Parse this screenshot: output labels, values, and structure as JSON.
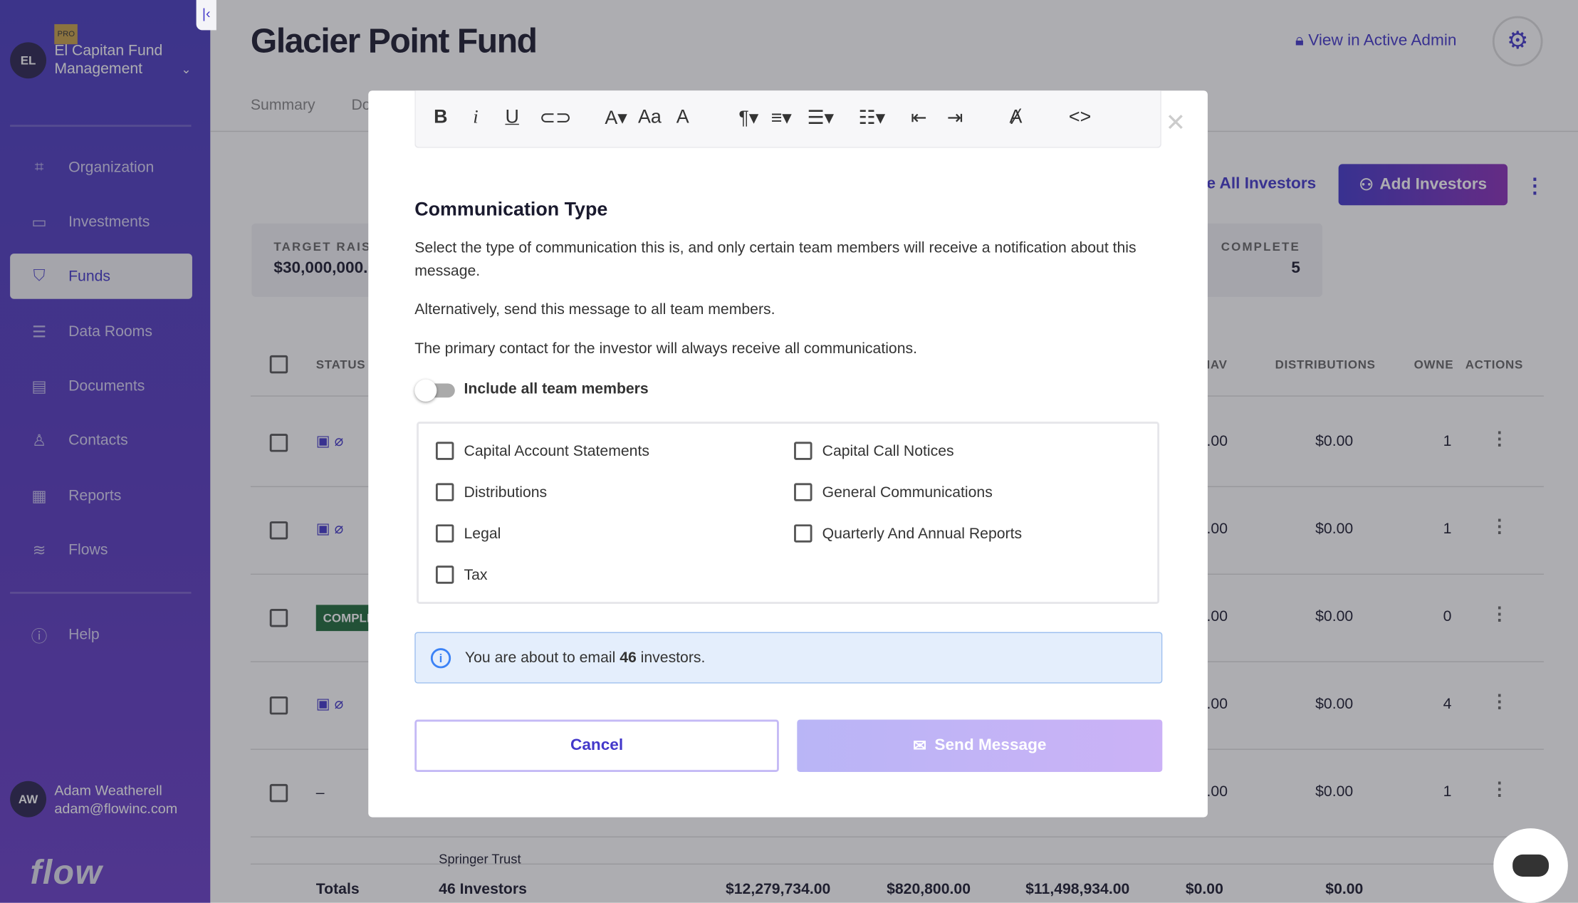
{
  "sidebar": {
    "org_initials": "EL",
    "org_name": "El Capitan Fund Management",
    "pro_badge": "PRO",
    "items": [
      {
        "label": "Organization",
        "icon": "org-icon"
      },
      {
        "label": "Investments",
        "icon": "briefcase-icon"
      },
      {
        "label": "Funds",
        "icon": "shield-check-icon"
      },
      {
        "label": "Data Rooms",
        "icon": "database-icon"
      },
      {
        "label": "Documents",
        "icon": "document-icon"
      },
      {
        "label": "Contacts",
        "icon": "person-icon"
      },
      {
        "label": "Reports",
        "icon": "table-icon"
      },
      {
        "label": "Flows",
        "icon": "layers-icon"
      }
    ],
    "help": "Help",
    "user": {
      "initials": "AW",
      "name": "Adam Weatherell",
      "email": "adam@flowinc.com"
    },
    "logo": "flow"
  },
  "header": {
    "title": "Glacier Point Fund",
    "admin_link": "View in Active Admin",
    "tabs": [
      "Summary",
      "Do"
    ]
  },
  "actions": {
    "all_investors": "e All Investors",
    "add_investors": "Add Investors"
  },
  "stats": [
    {
      "label": "TARGET RAIS",
      "value": "$30,000,000.0"
    },
    {
      "label": "COMPLETE",
      "value": "5"
    }
  ],
  "table": {
    "headers": {
      "status": "STATUS",
      "nav": "IAV",
      "distributions": "DISTRIBUTIONS",
      "owners": "OWNE",
      "actions": "ACTIONS"
    },
    "rows": [
      {
        "nav": ".00",
        "dist": "$0.00",
        "owners": "1"
      },
      {
        "nav": ".00",
        "dist": "$0.00",
        "owners": "1"
      },
      {
        "status": "COMPLE",
        "nav": ".00",
        "dist": "$0.00",
        "owners": "0"
      },
      {
        "nav": ".00",
        "dist": "$0.00",
        "owners": "4"
      },
      {
        "status": "–",
        "nav": ".00",
        "dist": "$0.00",
        "owners": "1"
      }
    ],
    "partial_text": [
      "Springer Trust"
    ],
    "totals": {
      "label": "Totals",
      "investors": "46 Investors",
      "v1": "$12,279,734.00",
      "v2": "$820,800.00",
      "v3": "$11,498,934.00",
      "v4": "$0.00",
      "v5": "$0.00"
    }
  },
  "modal": {
    "heading": "Communication Type",
    "desc1": "Select the type of communication this is, and only certain team members will receive a notification about this message.",
    "desc2": "Alternatively, send this message to all team members.",
    "desc3": "The primary contact for the investor will always receive all communications.",
    "toggle_label": "Include all team members",
    "toggle_on": false,
    "options": [
      "Capital Account Statements",
      "Capital Call Notices",
      "Distributions",
      "General Communications",
      "Legal",
      "Quarterly And Annual Reports",
      "Tax"
    ],
    "info_prefix": "You are about to email",
    "info_count": "46",
    "info_suffix": "investors.",
    "cancel": "Cancel",
    "send": "Send Message"
  }
}
